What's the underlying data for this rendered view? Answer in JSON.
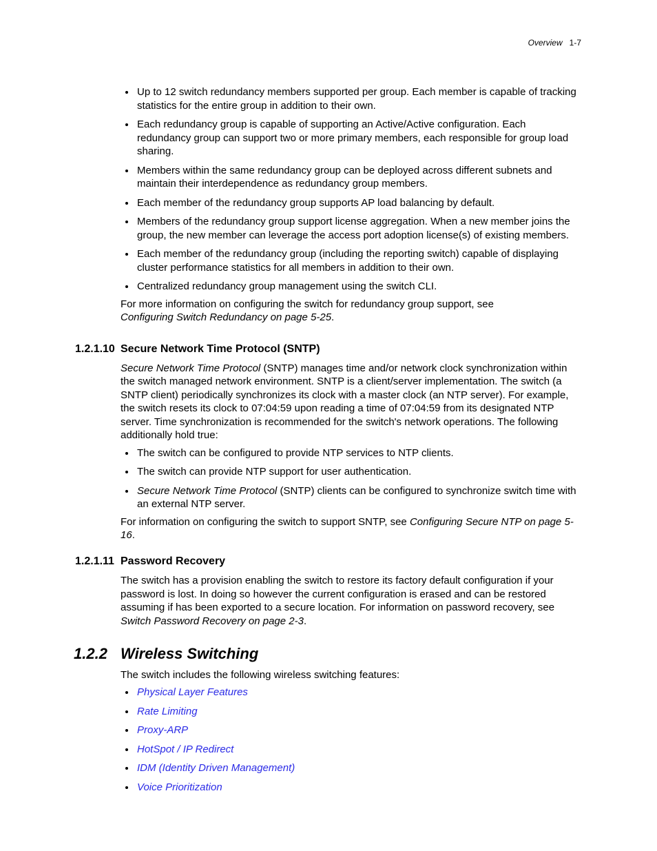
{
  "header": {
    "label": "Overview",
    "page": "1-7"
  },
  "redundancy_bullets": [
    "Up to 12 switch redundancy members supported per group. Each member is capable of tracking statistics for the entire group in addition to their own.",
    "Each redundancy group is capable of supporting an Active/Active configuration. Each redundancy group can support two or more primary members, each responsible for group load sharing.",
    "Members within the same redundancy group can be deployed across different subnets and maintain their interdependence as redundancy group members.",
    "Each member of the redundancy group supports AP load balancing by default.",
    "Members of the redundancy group support license aggregation. When a new member joins the group, the new member can leverage the access port adoption license(s) of existing members.",
    "Each member of the redundancy group (including the reporting switch) capable of displaying cluster performance statistics for all members in addition to their own.",
    "Centralized redundancy group management using the switch CLI."
  ],
  "redundancy_footer": {
    "line1": "For more information on configuring the switch for redundancy group support, see",
    "line2": "Configuring Switch Redundancy on page 5-25"
  },
  "sntp": {
    "num": "1.2.1.10",
    "title": "Secure Network Time Protocol (SNTP)",
    "intro_lead": "Secure Network Time Protocol",
    "intro_rest": " (SNTP) manages time and/or network clock synchronization within the switch managed network environment. SNTP is a client/server implementation. The switch (a SNTP client) periodically synchronizes its clock with a master clock (an NTP server). For example, the switch resets its clock to 07:04:59 upon reading a time of 07:04:59 from its designated NTP server. Time synchronization is recommended for the switch's network operations. The following additionally hold true:",
    "bullets": [
      "The switch can be configured to provide NTP services to NTP clients.",
      "The switch can provide NTP support for user authentication."
    ],
    "bullet3_lead": "Secure Network Time Protocol",
    "bullet3_rest": " (SNTP) clients can be configured to synchronize switch time with an external NTP server.",
    "footer_pre": "For information on configuring the switch to support SNTP, see ",
    "footer_ref": "Configuring Secure NTP on page 5-16"
  },
  "pw": {
    "num": "1.2.1.11",
    "title": "Password Recovery",
    "body": "The switch has a provision enabling the switch to restore its factory default configuration if your password is lost. In doing so however the current configuration is erased and can be restored assuming if has been exported to a secure location. For information on password recovery, see",
    "ref": "Switch Password Recovery on page 2-3"
  },
  "wireless": {
    "num": "1.2.2",
    "title": "Wireless Switching",
    "intro": "The switch includes the following wireless switching features:",
    "links": [
      "Physical Layer Features",
      "Rate Limiting",
      "Proxy-ARP",
      "HotSpot / IP Redirect",
      "IDM (Identity Driven Management)",
      "Voice Prioritization"
    ]
  },
  "dot": "."
}
